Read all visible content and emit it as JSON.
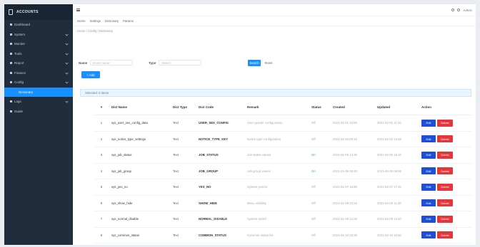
{
  "sidebar": {
    "brand": "ACCOUNTS",
    "items": [
      {
        "label": "Dashboard",
        "expandable": false
      },
      {
        "label": "System",
        "expandable": true
      },
      {
        "label": "Monitor",
        "expandable": true
      },
      {
        "label": "Tools",
        "expandable": true
      },
      {
        "label": "Report",
        "expandable": true
      },
      {
        "label": "Finance",
        "expandable": true
      },
      {
        "label": "Config",
        "expandable": true,
        "open": true
      },
      {
        "label": "Dictionary",
        "active": true
      },
      {
        "label": "Logs",
        "expandable": true
      },
      {
        "label": "Guide",
        "expandable": false
      }
    ]
  },
  "navbar": {
    "right": [
      "",
      "",
      "Admin"
    ]
  },
  "tags": [
    "Home",
    "Settings",
    "Dictionary",
    "Params"
  ],
  "breadcrumb": "Home / Config / Dictionary",
  "filters": [
    {
      "label": "Name",
      "placeholder": "Enter name"
    },
    {
      "label": "Type",
      "placeholder": "Select"
    }
  ],
  "buttons": {
    "search": "Search",
    "reset": "Reset",
    "add": "+ Add"
  },
  "info_text": "Selected: 0 items",
  "table": {
    "headers": [
      "#",
      "Dict Name",
      "Dict Type",
      "Dict Code",
      "Remark",
      "Status",
      "Created",
      "Updated",
      "Action"
    ],
    "rows": [
      [
        "1",
        "sys_user_sex_config_data",
        "Text",
        "USER_SEX_CONFIG",
        "User gender configuration",
        "Off",
        "2021-01-01 10:00",
        "2021-02-01 11:20"
      ],
      [
        "2",
        "sys_notice_type_settings",
        "Text",
        "NOTICE_TYPE_KEY",
        "Notice type configuration",
        "Off",
        "2021-01-03 09:12",
        "2021-02-03 13:45"
      ],
      [
        "3",
        "sys_job_status",
        "Text",
        "JOB_STATUS",
        "Job status values",
        "On",
        "2021-01-05 14:30",
        "2021-02-05 15:10"
      ],
      [
        "4",
        "sys_job_group",
        "Text",
        "JOB_GROUP",
        "Job group values",
        "On",
        "2021-01-06 08:40",
        "2021-02-06 09:55"
      ],
      [
        "5",
        "sys_yes_no",
        "Text",
        "YES_NO",
        "System yes/no",
        "Off",
        "2021-01-07 16:05",
        "2021-02-07 17:20"
      ],
      [
        "6",
        "sys_show_hide",
        "Text",
        "SHOW_HIDE",
        "Menu visibility",
        "Off",
        "2021-01-08 10:15",
        "2021-02-08 11:30"
      ],
      [
        "7",
        "sys_normal_disable",
        "Text",
        "NORMAL_DISABLE",
        "System switch",
        "Off",
        "2021-01-09 12:25",
        "2021-02-09 13:40"
      ],
      [
        "8",
        "sys_common_status",
        "Text",
        "COMMON_STATUS",
        "Common status list",
        "Off",
        "2021-01-10 15:35",
        "2021-02-10 16:50"
      ]
    ],
    "row_buttons": {
      "edit": "Edit",
      "delete": "Delete"
    }
  },
  "colors": {
    "accent": "#1890ff",
    "sidebar": "#1f2d3d",
    "edit": "#1f4ed8",
    "delete": "#e5363b"
  }
}
